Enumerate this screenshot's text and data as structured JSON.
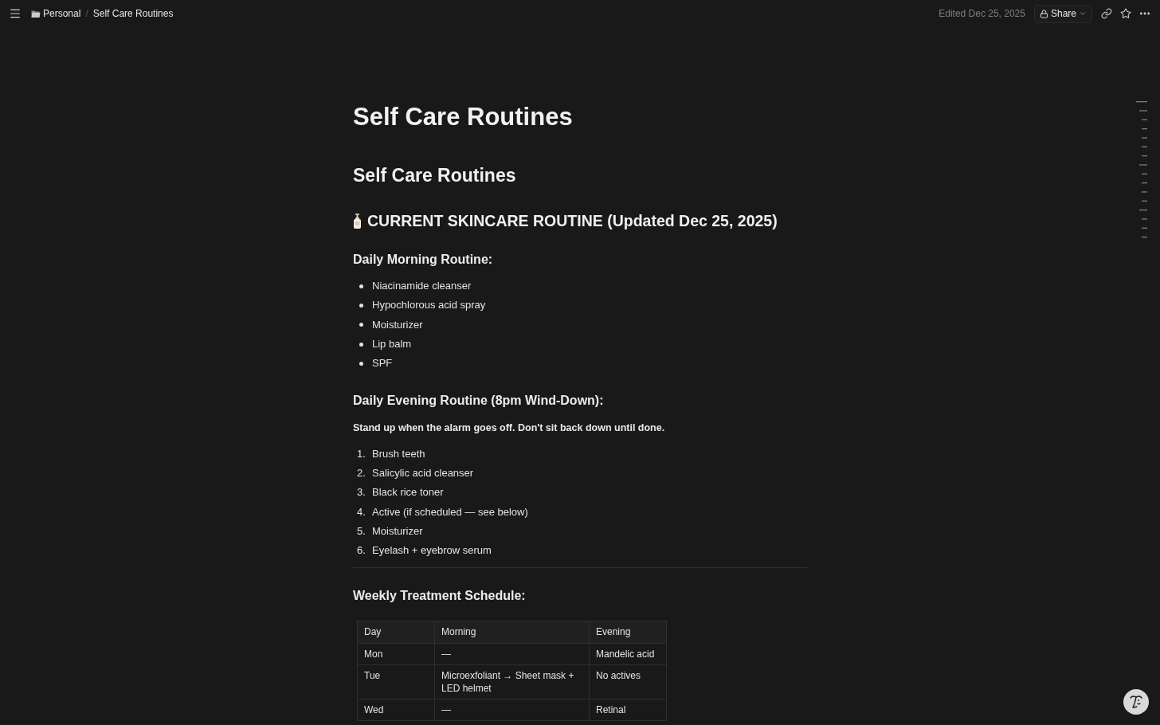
{
  "topbar": {
    "breadcrumbs": [
      {
        "label": "Personal"
      },
      {
        "label": "Self Care Routines"
      }
    ],
    "separator": "/",
    "edited": "Edited Dec 25, 2025",
    "share_label": "Share"
  },
  "page": {
    "title": "Self Care Routines",
    "blocks": [
      {
        "kind": "h1",
        "text": "Self Care Routines"
      },
      {
        "kind": "h2",
        "text": "CURRENT SKINCARE ROUTINE (Updated Dec 25, 2025)"
      },
      {
        "kind": "h3",
        "text": "Daily Morning Routine:"
      },
      {
        "kind": "bullets",
        "items": [
          "Niacinamide cleanser",
          "Hypochlorous acid spray",
          "Moisturizer",
          "Lip balm",
          "SPF"
        ]
      },
      {
        "kind": "h3",
        "text": "Daily Evening Routine (8pm Wind-Down):"
      },
      {
        "kind": "bold_paragraph",
        "text": "Stand up when the alarm goes off. Don't sit back down until done."
      },
      {
        "kind": "numbered",
        "items": [
          {
            "number": "1.",
            "text": "Brush teeth"
          },
          {
            "number": "2.",
            "text": "Salicylic acid cleanser"
          },
          {
            "number": "3.",
            "text": "Black rice toner"
          },
          {
            "number": "4.",
            "text": "Active (if scheduled — see below)"
          },
          {
            "number": "5.",
            "text": "Moisturizer"
          },
          {
            "number": "6.",
            "text": "Eyelash + eyebrow serum"
          }
        ]
      },
      {
        "kind": "divider"
      },
      {
        "kind": "h3",
        "text": "Weekly Treatment Schedule:"
      },
      {
        "kind": "table",
        "columns": [
          "Day",
          "Morning",
          "Evening"
        ],
        "rows": [
          [
            "Mon",
            "—",
            "Mandelic acid"
          ],
          [
            "Tue",
            "Microexfoliant → Sheet mask + LED helmet",
            "No actives"
          ],
          [
            "Wed",
            "—",
            "Retinal"
          ]
        ]
      }
    ]
  }
}
